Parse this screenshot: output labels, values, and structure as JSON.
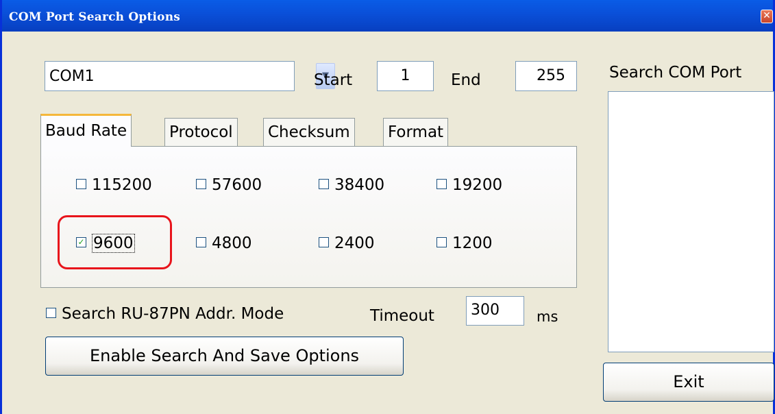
{
  "window": {
    "title": "COM Port Search Options",
    "close_glyph": "✕"
  },
  "com_select": {
    "value": "COM1",
    "dropdown_icon": "chevron-down-icon"
  },
  "range": {
    "start_label": "Start",
    "start_value": "1",
    "end_label": "End",
    "end_value": "255"
  },
  "tabs": [
    {
      "label": "Baud Rate",
      "active": true
    },
    {
      "label": "Protocol",
      "active": false
    },
    {
      "label": "Checksum",
      "active": false
    },
    {
      "label": "Format",
      "active": false
    }
  ],
  "baud_rates": [
    {
      "label": "115200",
      "checked": false
    },
    {
      "label": "57600",
      "checked": false
    },
    {
      "label": "38400",
      "checked": false
    },
    {
      "label": "19200",
      "checked": false
    },
    {
      "label": "9600",
      "checked": true
    },
    {
      "label": "4800",
      "checked": false
    },
    {
      "label": "2400",
      "checked": false
    },
    {
      "label": "1200",
      "checked": false
    }
  ],
  "addr_mode": {
    "label": "Search RU-87PN Addr. Mode",
    "checked": false
  },
  "timeout": {
    "label": "Timeout",
    "value": "300",
    "unit": "ms"
  },
  "enable_button": {
    "label": "Enable Search And Save  Options"
  },
  "search_panel": {
    "label": "Search COM Port"
  },
  "exit_button": {
    "label": "Exit"
  },
  "colors": {
    "titlebar": "#0a5ce6",
    "window_bg": "#ece9d8",
    "highlight": "#e8141b",
    "check": "#21a121"
  }
}
